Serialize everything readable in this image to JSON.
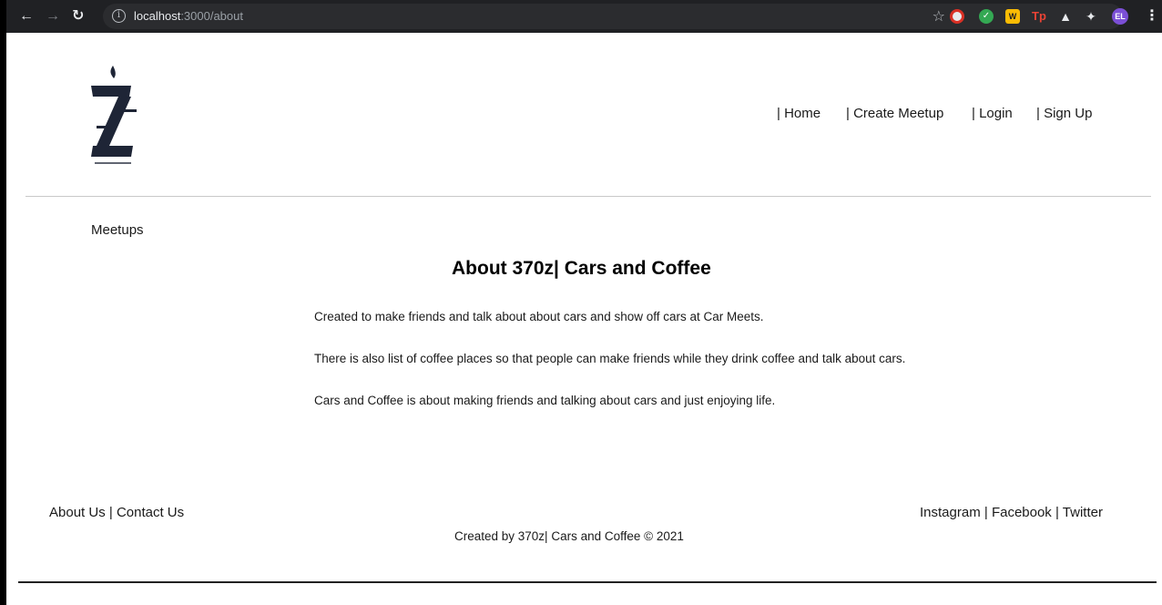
{
  "browser": {
    "url_host": "localhost",
    "url_path": ":3000/about",
    "profile_initials": "EL"
  },
  "header": {
    "logo_icon": "z-logo-with-flame",
    "nav": [
      {
        "label": "| Home"
      },
      {
        "label": "| Create Meetup"
      },
      {
        "label": "| Login"
      },
      {
        "label": "| Sign Up"
      }
    ]
  },
  "sidebar": {
    "meetups_label": "Meetups"
  },
  "main": {
    "title": "About 370z| Cars and Coffee",
    "paragraphs": [
      "Created to make friends and talk about about cars and show off cars at Car Meets.",
      "There is also list of coffee places so that people can make friends while they drink coffee and talk about cars.",
      "Cars and Coffee is about making friends and talking about cars and just enjoying life."
    ]
  },
  "footer": {
    "left_links": [
      "About Us",
      "Contact Us"
    ],
    "right_links": [
      "Instagram",
      "Facebook",
      "Twitter"
    ],
    "separator": " | ",
    "copyright": "Created by 370z| Cars and Coffee © 2021"
  },
  "colors": {
    "logo_navy": "#1e2536",
    "chrome_bg": "#202124"
  }
}
